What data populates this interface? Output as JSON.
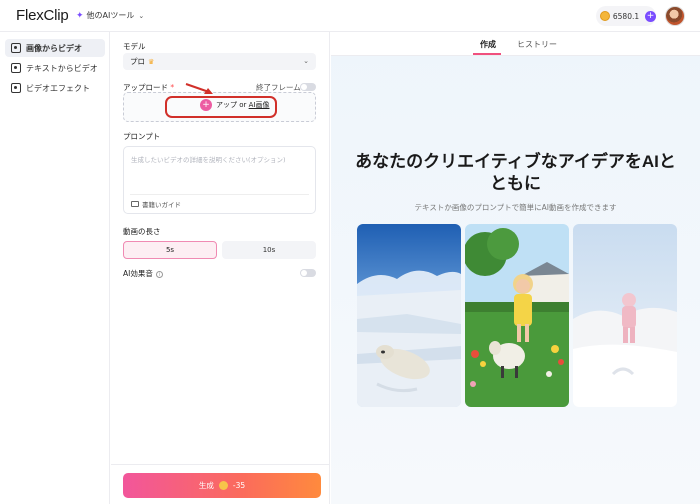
{
  "app": {
    "logo": "FlexClip",
    "ai_tools_label": "他のAIツール",
    "credits": "6580.1"
  },
  "nav": {
    "items": [
      {
        "label": "画像からビデオ",
        "icon": "image-video-icon"
      },
      {
        "label": "テキストからビデオ",
        "icon": "text-video-icon"
      },
      {
        "label": "ビデオエフェクト",
        "icon": "video-effect-icon"
      }
    ]
  },
  "form": {
    "model_label": "モデル",
    "model_value": "プロ",
    "upload_label": "アップロード",
    "upload_required": "*",
    "end_frame_label": "終了フレーム",
    "upload_button_prefix": "アップ or ",
    "upload_button_link": "AI画像",
    "prompt_label": "プロンプト",
    "prompt_placeholder": "生成したいビデオの詳細を説明ください(オプション)",
    "guide_label": "書籍いガイド",
    "duration_label": "動画の長さ",
    "durations": [
      "5s",
      "10s"
    ],
    "ai_sound_label": "AI効果音",
    "generate_label": "生成",
    "generate_cost": "-35"
  },
  "tabs": [
    "作成",
    "ヒストリー"
  ],
  "hero": {
    "title_line1": "あなたのクリエイティブなアイデアをAIと",
    "title_line2": "ともに",
    "subtitle": "テキストか画像のプロンプトで簡単にAI動画を作成できます"
  },
  "colors": {
    "accent": "#f0507e",
    "brand_purple": "#7a4cff",
    "highlight_red": "#d1302a"
  }
}
